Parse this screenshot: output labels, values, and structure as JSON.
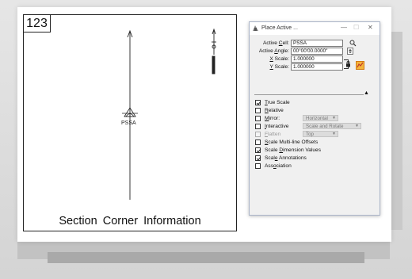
{
  "drawing": {
    "cell_number": "123",
    "symbol_label": "PSSA",
    "caption": "Section  Corner  Information"
  },
  "dialog": {
    "title": "Place Active ...",
    "minimize_glyph": "—",
    "maximize_glyph": "☐",
    "close_glyph": "✕",
    "active_cell_label": "Active Cell:",
    "active_cell_value": "PSSA",
    "active_angle_label": "Active Angle:",
    "active_angle_value": "00°00'00.0000\"",
    "x_scale_label": "X Scale:",
    "x_scale_value": "1.000000",
    "y_scale_label": "Y Scale:",
    "y_scale_value": "1.000000",
    "options": {
      "true_scale": {
        "label": "True Scale",
        "checked": true
      },
      "relative": {
        "label": "Relative",
        "checked": false
      },
      "mirror": {
        "label": "Mirror:",
        "checked": false,
        "value": "Horizontal"
      },
      "interactive": {
        "label": "Interactive",
        "checked": false,
        "value": "Scale and Rotate"
      },
      "flatten": {
        "label": "Flatten",
        "checked": false,
        "value": "Top"
      },
      "scale_multiline": {
        "label": "Scale Multi-line Offsets",
        "checked": false
      },
      "scale_dimension": {
        "label": "Scale Dimension Values",
        "checked": true
      },
      "scale_annotations": {
        "label": "Scale Annotations",
        "checked": true
      },
      "association": {
        "label": "Association",
        "checked": false
      }
    }
  },
  "colors": {
    "accent": "#e06a1c",
    "window_bg": "#f0f0f0",
    "border": "#aab4c8"
  }
}
